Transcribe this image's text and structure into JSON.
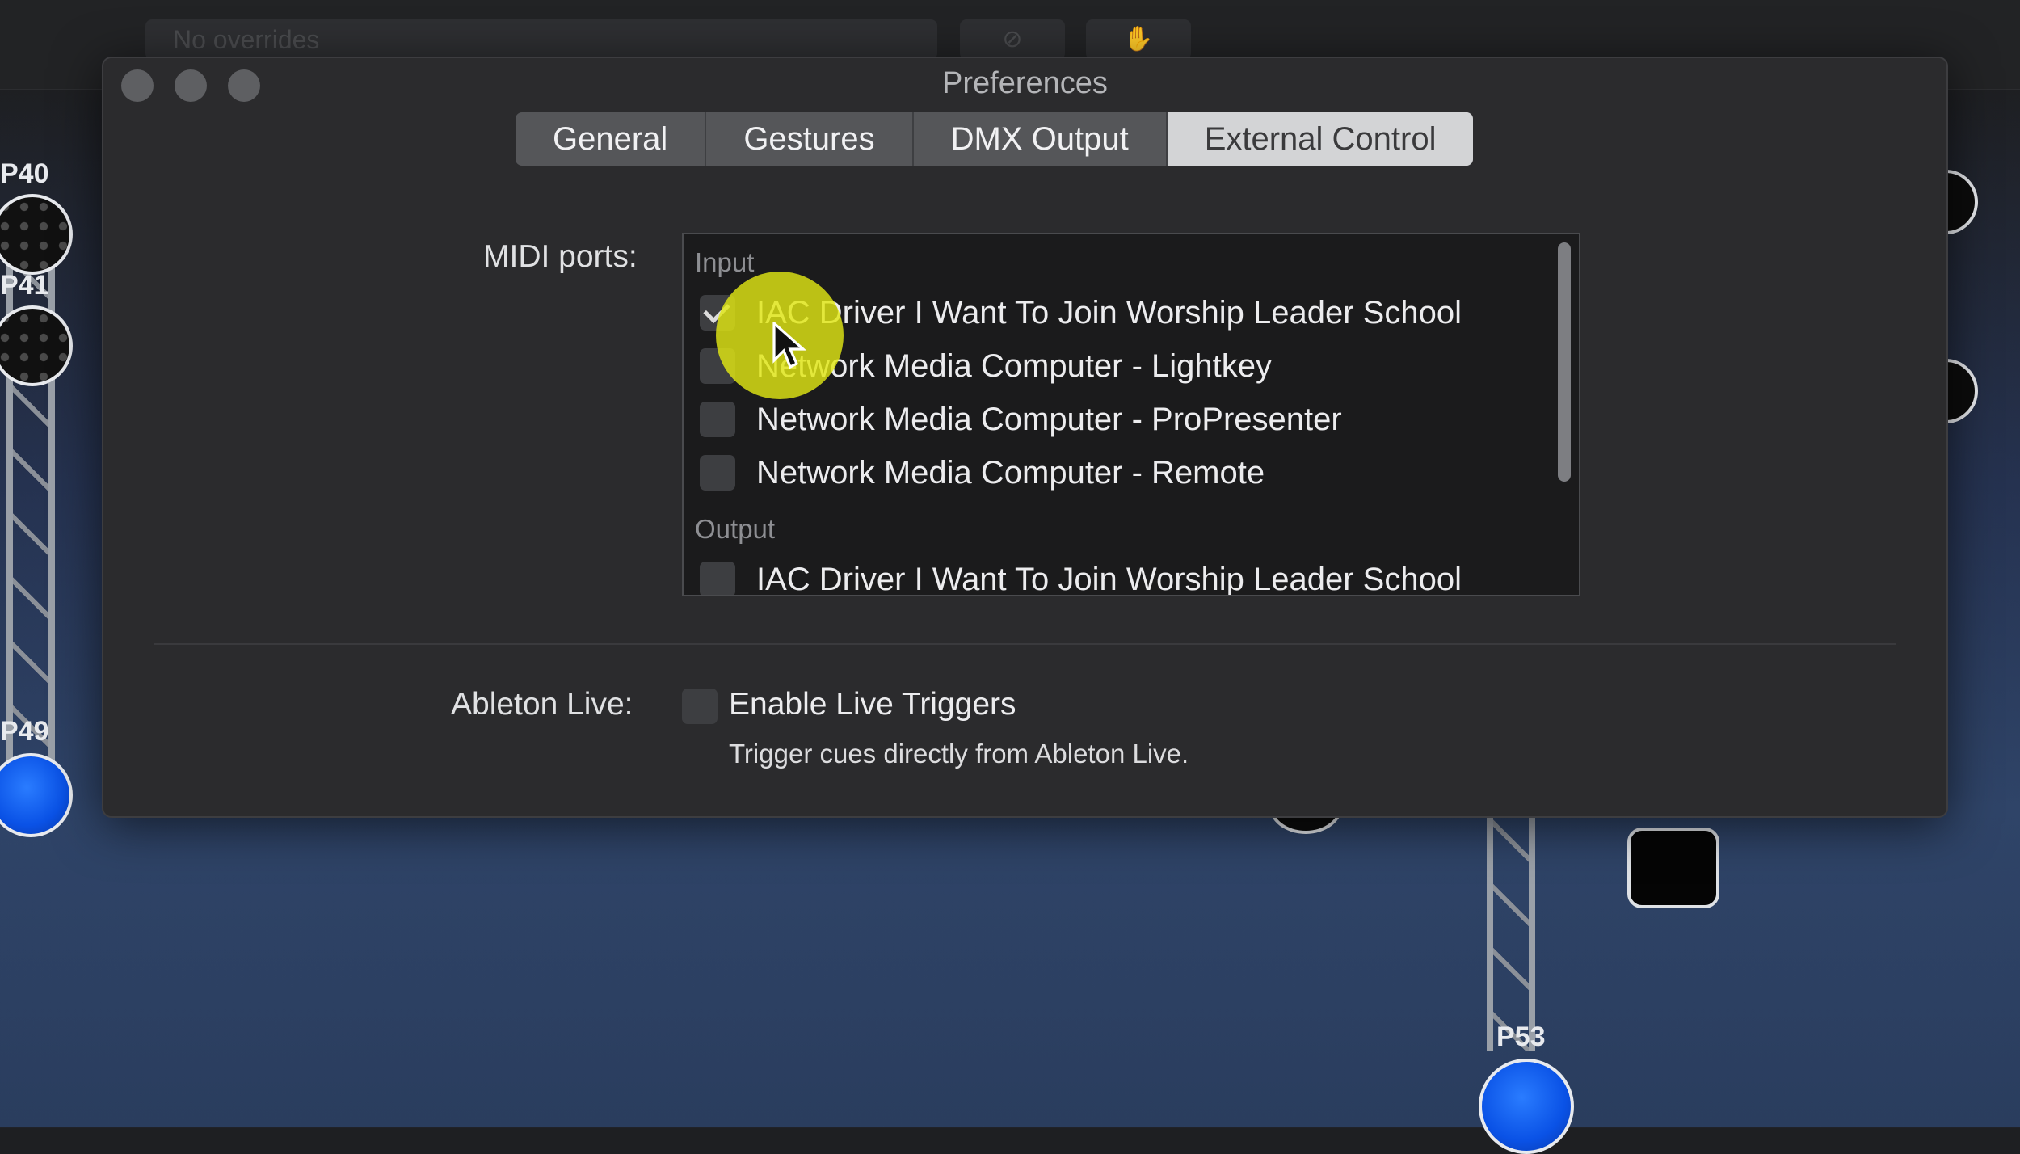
{
  "background": {
    "overrides_placeholder": "No overrides",
    "fixtures": [
      "P40",
      "P41",
      "P49",
      "P53"
    ]
  },
  "dialog": {
    "title": "Preferences",
    "tabs": [
      {
        "label": "General",
        "selected": false
      },
      {
        "label": "Gestures",
        "selected": false
      },
      {
        "label": "DMX Output",
        "selected": false
      },
      {
        "label": "External Control",
        "selected": true
      }
    ],
    "midi": {
      "label": "MIDI ports:",
      "input_header": "Input",
      "input_ports": [
        {
          "name": "IAC Driver I Want To Join Worship Leader School",
          "checked": true
        },
        {
          "name": "Network Media Computer - Lightkey",
          "checked": false
        },
        {
          "name": "Network Media Computer - ProPresenter",
          "checked": false
        },
        {
          "name": "Network Media Computer - Remote",
          "checked": false
        }
      ],
      "output_header": "Output",
      "output_ports": [
        {
          "name": "IAC Driver I Want To Join Worship Leader School",
          "checked": false
        }
      ]
    },
    "ableton": {
      "label": "Ableton Live:",
      "checkbox_label": "Enable Live Triggers",
      "checked": false,
      "hint": "Trigger cues directly from Ableton Live."
    }
  },
  "colors": {
    "highlight": "#e1e614",
    "selected_tab": "#d3d4d6",
    "fixture_blue": "#0a52e6"
  }
}
